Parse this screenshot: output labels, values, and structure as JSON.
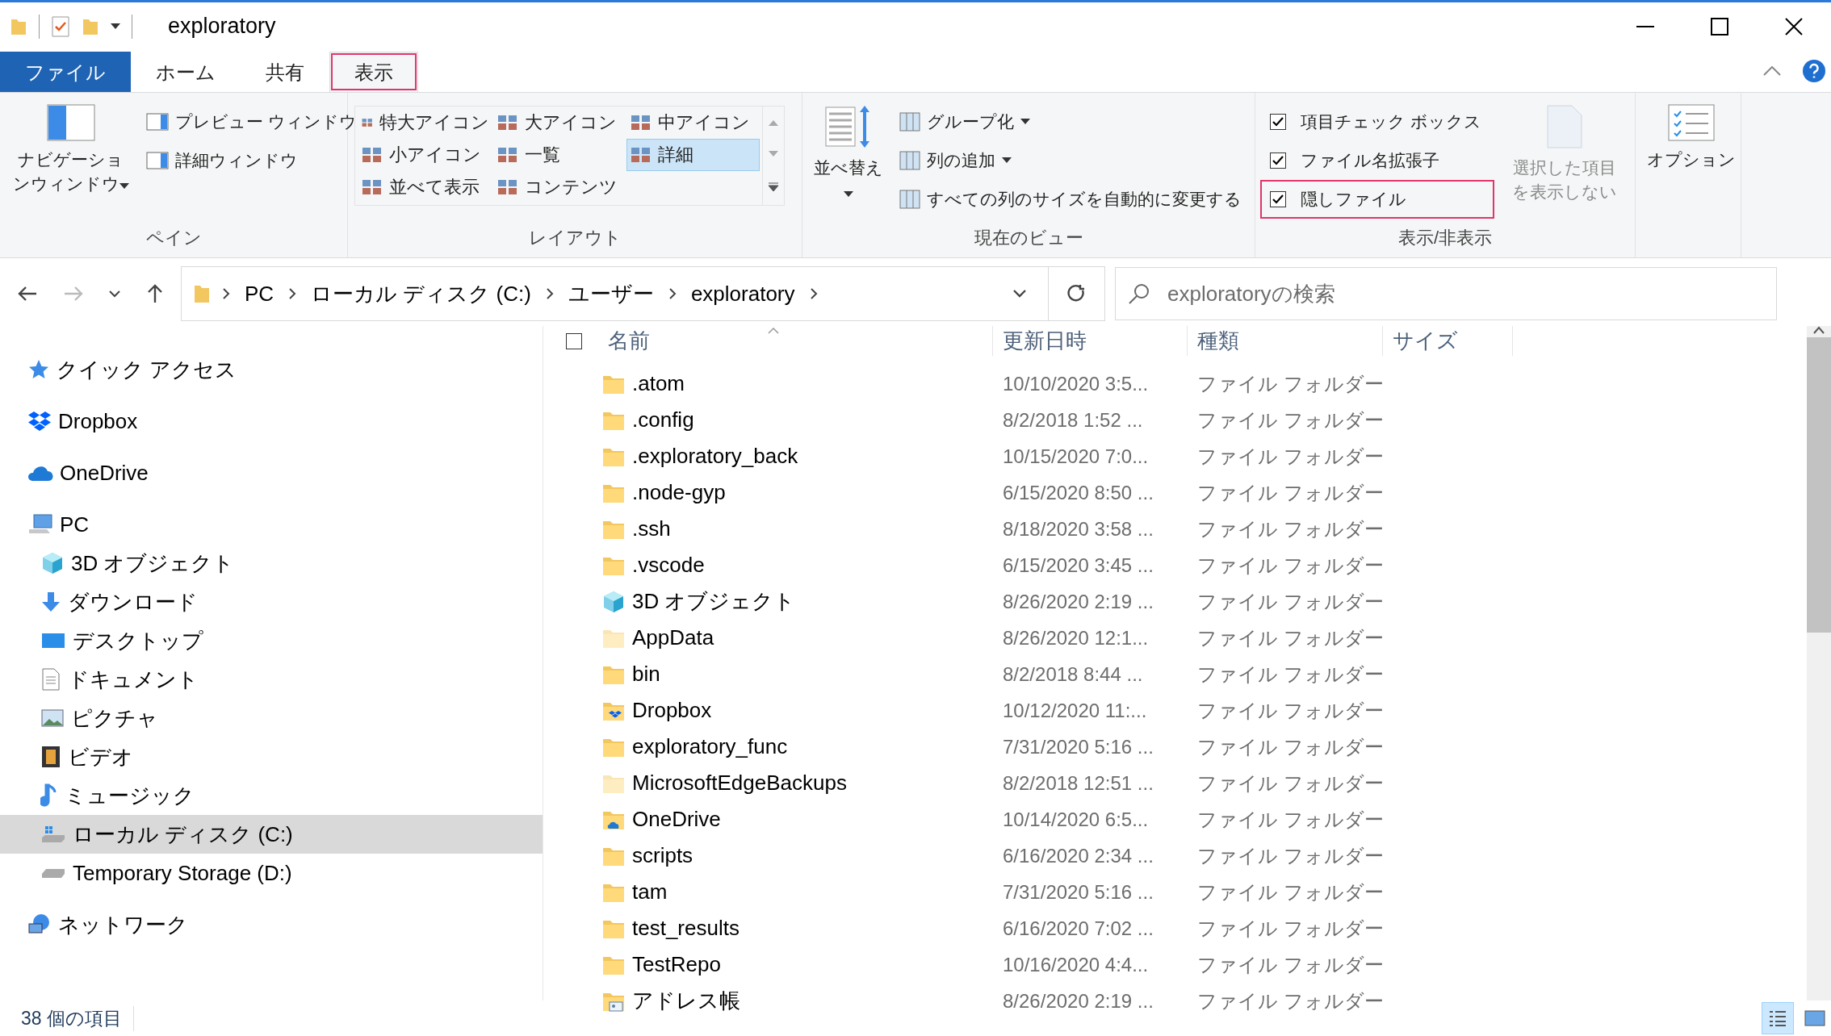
{
  "window": {
    "title": "exploratory"
  },
  "ribbon_tabs": [
    {
      "label": "ファイル",
      "kind": "file",
      "selected": false,
      "highlighted": false
    },
    {
      "label": "ホーム",
      "kind": "tab",
      "selected": false,
      "highlighted": false
    },
    {
      "label": "共有",
      "kind": "tab",
      "selected": false,
      "highlighted": false
    },
    {
      "label": "表示",
      "kind": "tab",
      "selected": true,
      "highlighted": true
    }
  ],
  "ribbon": {
    "pane": {
      "label": "ペイン",
      "navigation_button": "ナビゲーションウィンドウ",
      "buttons": [
        "プレビュー ウィンドウ",
        "詳細ウィンドウ"
      ]
    },
    "layout": {
      "label": "レイアウト",
      "options": [
        {
          "label": "特大アイコン",
          "selected": false
        },
        {
          "label": "大アイコン",
          "selected": false
        },
        {
          "label": "中アイコン",
          "selected": false
        },
        {
          "label": "小アイコン",
          "selected": false
        },
        {
          "label": "一覧",
          "selected": false
        },
        {
          "label": "詳細",
          "selected": true
        },
        {
          "label": "並べて表示",
          "selected": false
        },
        {
          "label": "コンテンツ",
          "selected": false
        }
      ]
    },
    "current_view": {
      "label": "現在のビュー",
      "sort_button": "並べ替え",
      "buttons": [
        {
          "label": "グループ化",
          "dropdown": true
        },
        {
          "label": "列の追加",
          "dropdown": true
        },
        {
          "label": "すべての列のサイズを自動的に変更する",
          "dropdown": false
        }
      ]
    },
    "show_hide": {
      "label": "表示/非表示",
      "checkboxes": [
        {
          "label": "項目チェック ボックス",
          "checked": true,
          "highlighted": false
        },
        {
          "label": "ファイル名拡張子",
          "checked": true,
          "highlighted": false
        },
        {
          "label": "隠しファイル",
          "checked": true,
          "highlighted": true
        }
      ],
      "hide_selected": {
        "label": "選択した項目を表示しない",
        "disabled": true
      }
    },
    "options_button": "オプション"
  },
  "address_bar": {
    "path": [
      "PC",
      "ローカル ディスク (C:)",
      "ユーザー",
      "exploratory"
    ]
  },
  "search": {
    "placeholder": "exploratoryの検索"
  },
  "navigation": [
    {
      "label": "クイック アクセス",
      "kind": "star",
      "selected": false
    },
    {
      "label": "Dropbox",
      "kind": "dropbox",
      "selected": false
    },
    {
      "label": "OneDrive",
      "kind": "onedrive",
      "selected": false
    },
    {
      "label": "PC",
      "kind": "pc",
      "selected": false,
      "children": [
        {
          "label": "3D オブジェクト",
          "kind": "cube",
          "selected": false
        },
        {
          "label": "ダウンロード",
          "kind": "download",
          "selected": false
        },
        {
          "label": "デスクトップ",
          "kind": "desktop",
          "selected": false
        },
        {
          "label": "ドキュメント",
          "kind": "document",
          "selected": false
        },
        {
          "label": "ピクチャ",
          "kind": "picture",
          "selected": false
        },
        {
          "label": "ビデオ",
          "kind": "video",
          "selected": false
        },
        {
          "label": "ミュージック",
          "kind": "music",
          "selected": false
        },
        {
          "label": "ローカル ディスク (C:)",
          "kind": "windows_drive",
          "selected": true
        },
        {
          "label": "Temporary Storage (D:)",
          "kind": "drive",
          "selected": false
        }
      ]
    },
    {
      "label": "ネットワーク",
      "kind": "network",
      "selected": false
    }
  ],
  "table": {
    "select_all": {
      "checked": false
    },
    "columns": [
      "名前",
      "更新日時",
      "種類",
      "サイズ"
    ],
    "rows": [
      {
        "name": ".atom",
        "modified": "10/10/2020 3:5...",
        "type": "ファイル フォルダー",
        "kind": "folder",
        "hidden": false
      },
      {
        "name": ".config",
        "modified": "8/2/2018 1:52 ...",
        "type": "ファイル フォルダー",
        "kind": "folder",
        "hidden": false
      },
      {
        "name": ".exploratory_back",
        "modified": "10/15/2020 7:0...",
        "type": "ファイル フォルダー",
        "kind": "folder",
        "hidden": false
      },
      {
        "name": ".node-gyp",
        "modified": "6/15/2020 8:50 ...",
        "type": "ファイル フォルダー",
        "kind": "folder",
        "hidden": false
      },
      {
        "name": ".ssh",
        "modified": "8/18/2020 3:58 ...",
        "type": "ファイル フォルダー",
        "kind": "folder",
        "hidden": false
      },
      {
        "name": ".vscode",
        "modified": "6/15/2020 3:45 ...",
        "type": "ファイル フォルダー",
        "kind": "folder",
        "hidden": false
      },
      {
        "name": "3D オブジェクト",
        "modified": "8/26/2020 2:19 ...",
        "type": "ファイル フォルダー",
        "kind": "cube",
        "hidden": false
      },
      {
        "name": "AppData",
        "modified": "8/26/2020 12:1...",
        "type": "ファイル フォルダー",
        "kind": "folder",
        "hidden": true
      },
      {
        "name": "bin",
        "modified": "8/2/2018 8:44 ...",
        "type": "ファイル フォルダー",
        "kind": "folder",
        "hidden": false
      },
      {
        "name": "Dropbox",
        "modified": "10/12/2020 11:...",
        "type": "ファイル フォルダー",
        "kind": "dropbox",
        "hidden": false
      },
      {
        "name": "exploratory_func",
        "modified": "7/31/2020 5:16 ...",
        "type": "ファイル フォルダー",
        "kind": "folder",
        "hidden": false
      },
      {
        "name": "MicrosoftEdgeBackups",
        "modified": "8/2/2018 12:51 ...",
        "type": "ファイル フォルダー",
        "kind": "folder",
        "hidden": true
      },
      {
        "name": "OneDrive",
        "modified": "10/14/2020 6:5...",
        "type": "ファイル フォルダー",
        "kind": "onedrive",
        "hidden": false
      },
      {
        "name": "scripts",
        "modified": "6/16/2020 2:34 ...",
        "type": "ファイル フォルダー",
        "kind": "folder",
        "hidden": false
      },
      {
        "name": "tam",
        "modified": "7/31/2020 5:16 ...",
        "type": "ファイル フォルダー",
        "kind": "folder",
        "hidden": false
      },
      {
        "name": "test_results",
        "modified": "6/16/2020 7:02 ...",
        "type": "ファイル フォルダー",
        "kind": "folder",
        "hidden": false
      },
      {
        "name": "TestRepo",
        "modified": "10/16/2020 4:4...",
        "type": "ファイル フォルダー",
        "kind": "folder",
        "hidden": false
      },
      {
        "name": "アドレス帳",
        "modified": "8/26/2020 2:19 ...",
        "type": "ファイル フォルダー",
        "kind": "contacts",
        "hidden": false
      }
    ]
  },
  "status_bar": {
    "text": "38 個の項目",
    "view_buttons": [
      {
        "kind": "details",
        "selected": true
      },
      {
        "kind": "large_icons",
        "selected": false
      }
    ]
  }
}
